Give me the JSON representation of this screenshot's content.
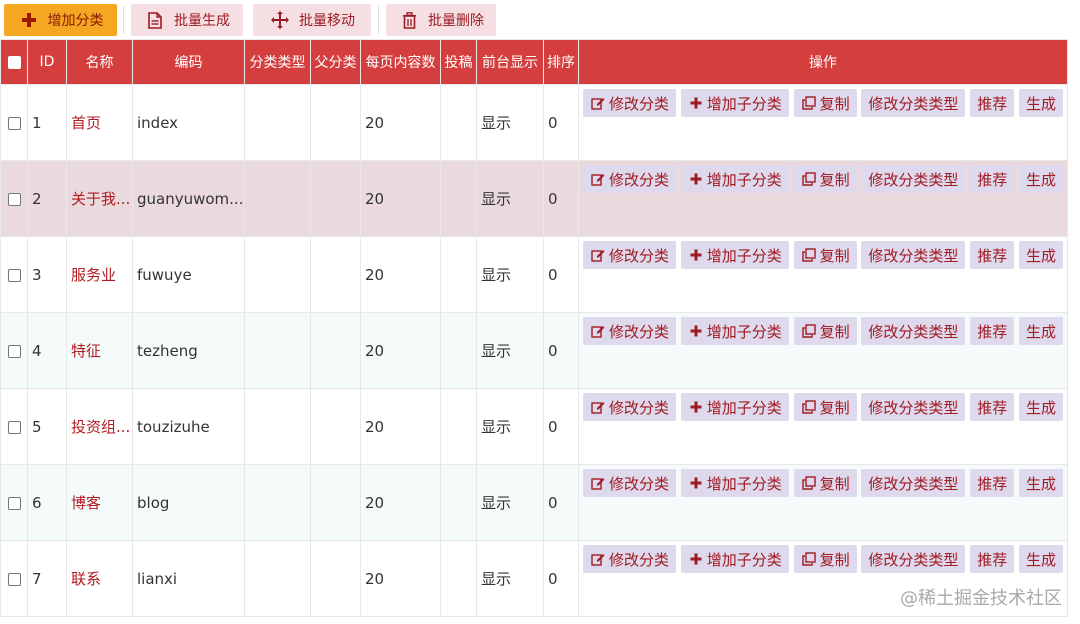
{
  "toolbar": {
    "add_label": "增加分类",
    "batch_generate_label": "批量生成",
    "batch_move_label": "批量移动",
    "batch_delete_label": "批量删除"
  },
  "columns": {
    "id": "ID",
    "name": "名称",
    "code": "编码",
    "type": "分类类型",
    "parent": "父分类",
    "page_size": "每页内容数",
    "submit": "投稿",
    "frontend": "前台显示",
    "sort": "排序",
    "ops": "操作"
  },
  "actions": {
    "edit": "修改分类",
    "add_child": "增加子分类",
    "copy": "复制",
    "edit_type": "修改分类类型",
    "recommend": "推荐",
    "generate": "生成"
  },
  "rows": [
    {
      "id": "1",
      "name": "首页",
      "code": "index",
      "type": "",
      "parent": "",
      "page_size": "20",
      "frontend": "显示",
      "sort": "0"
    },
    {
      "id": "2",
      "name": "关于我...",
      "code": "guanyuwom...",
      "type": "",
      "parent": "",
      "page_size": "20",
      "frontend": "显示",
      "sort": "0"
    },
    {
      "id": "3",
      "name": "服务业",
      "code": "fuwuye",
      "type": "",
      "parent": "",
      "page_size": "20",
      "frontend": "显示",
      "sort": "0"
    },
    {
      "id": "4",
      "name": "特征",
      "code": "tezheng",
      "type": "",
      "parent": "",
      "page_size": "20",
      "frontend": "显示",
      "sort": "0"
    },
    {
      "id": "5",
      "name": "投资组...",
      "code": "touzizuhe",
      "type": "",
      "parent": "",
      "page_size": "20",
      "frontend": "显示",
      "sort": "0"
    },
    {
      "id": "6",
      "name": "博客",
      "code": "blog",
      "type": "",
      "parent": "",
      "page_size": "20",
      "frontend": "显示",
      "sort": "0"
    },
    {
      "id": "7",
      "name": "联系",
      "code": "lianxi",
      "type": "",
      "parent": "",
      "page_size": "20",
      "frontend": "显示",
      "sort": "0"
    }
  ],
  "watermark": "@稀土掘金技术社区",
  "colors": {
    "header_bg": "#d43e3e",
    "primary_button": "#f5a623",
    "action_button_bg": "#ded9ec",
    "action_text": "#a01b22",
    "highlight_row": "#eadade"
  }
}
